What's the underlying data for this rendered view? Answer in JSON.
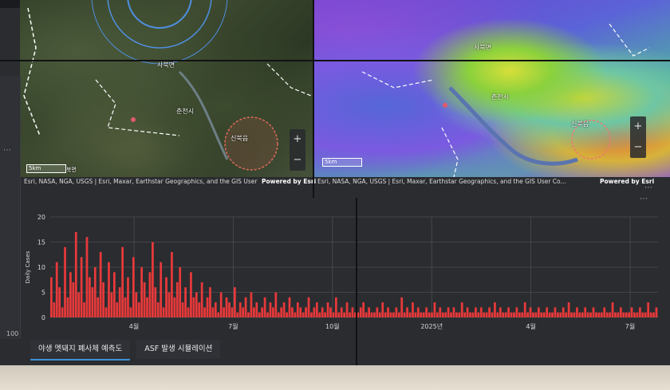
{
  "map_left": {
    "labels": [
      "사북면",
      "신북읍",
      "춘천시"
    ],
    "scale": "5km",
    "scale_suffix": "북면",
    "attribution": "Esri, NASA, NGA, USGS | Esri, Maxar, Earthstar Geographics, and the GIS User Commu...",
    "powered": "Powered by Esri",
    "zoom_in": "+",
    "zoom_out": "−"
  },
  "map_right": {
    "labels": [
      "사북면",
      "춘천시",
      "신북읍"
    ],
    "scale": "5km",
    "attribution": "Esri, NASA, NGA, USGS | Esri, Maxar, Earthstar Geographics, and the GIS User Co...",
    "powered": "Powered by Esri",
    "zoom_in": "+",
    "zoom_out": "−"
  },
  "side_value": "100",
  "tabs": [
    {
      "label": "야생 멧돼지 폐사체 예측도"
    },
    {
      "label": "ASF 발생 시뮬레이션"
    }
  ],
  "colors": {
    "bar": "#e8393a",
    "grid": "#4a4d52",
    "tab_accent": "#3f8fd6"
  },
  "chart_data": {
    "type": "bar",
    "ylabel": "Daily Cases",
    "ylim": [
      0,
      20
    ],
    "yticks": [
      0,
      5,
      10,
      15,
      20
    ],
    "xtick_labels": [
      "4월",
      "7월",
      "10월",
      "2025년",
      "4월",
      "7월"
    ],
    "values": [
      8,
      3,
      11,
      6,
      2,
      14,
      4,
      9,
      7,
      17,
      5,
      12,
      3,
      16,
      8,
      6,
      10,
      4,
      13,
      7,
      2,
      11,
      5,
      9,
      3,
      6,
      14,
      4,
      8,
      2,
      12,
      5,
      3,
      10,
      7,
      4,
      9,
      15,
      6,
      3,
      11,
      2,
      8,
      5,
      13,
      4,
      7,
      10,
      3,
      6,
      2,
      9,
      4,
      5,
      3,
      7,
      2,
      4,
      6,
      2,
      3,
      1,
      5,
      2,
      4,
      3,
      2,
      6,
      1,
      3,
      2,
      4,
      1,
      5,
      2,
      3,
      1,
      2,
      4,
      1,
      3,
      2,
      5,
      1,
      2,
      3,
      1,
      4,
      2,
      1,
      3,
      2,
      1,
      2,
      4,
      1,
      2,
      3,
      1,
      2,
      1,
      3,
      2,
      1,
      4,
      1,
      2,
      1,
      3,
      1,
      2,
      1,
      1,
      2,
      3,
      1,
      2,
      1,
      1,
      2,
      1,
      3,
      1,
      2,
      1,
      1,
      2,
      1,
      4,
      1,
      2,
      1,
      3,
      1,
      2,
      1,
      1,
      2,
      1,
      1,
      3,
      1,
      2,
      1,
      1,
      2,
      1,
      2,
      1,
      1,
      3,
      1,
      2,
      1,
      1,
      2,
      1,
      2,
      1,
      1,
      2,
      1,
      3,
      1,
      2,
      1,
      1,
      2,
      1,
      1,
      2,
      1,
      1,
      3,
      1,
      2,
      1,
      1,
      2,
      1,
      1,
      2,
      1,
      1,
      2,
      1,
      1,
      2,
      1,
      3,
      1,
      1,
      2,
      1,
      1,
      2,
      1,
      1,
      2,
      1,
      1,
      1,
      2,
      1,
      1,
      3,
      1,
      1,
      2,
      1,
      1,
      1,
      2,
      1,
      1,
      2,
      1,
      1,
      3,
      1,
      1,
      2
    ]
  }
}
